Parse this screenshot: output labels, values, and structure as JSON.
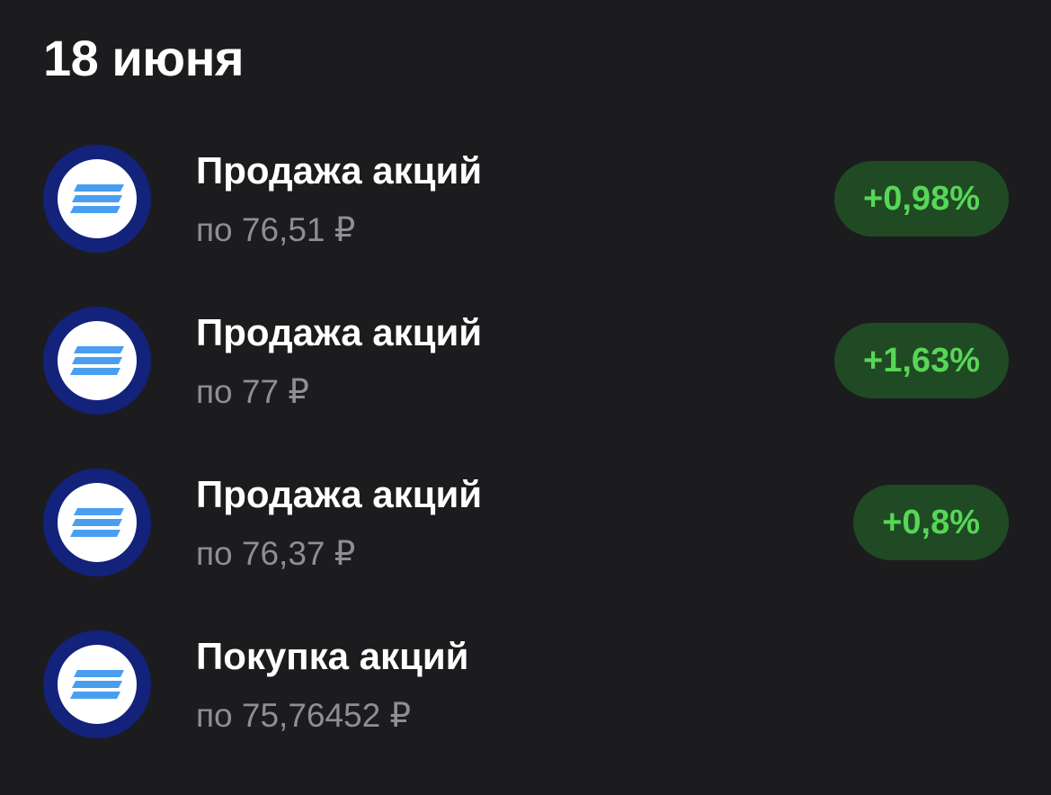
{
  "date_header": "18 июня",
  "operations": [
    {
      "title": "Продажа акций",
      "price": "по 76,51 ₽",
      "change": "+0,98%",
      "icon": "stock-logo-icon"
    },
    {
      "title": "Продажа акций",
      "price": "по 77 ₽",
      "change": "+1,63%",
      "icon": "stock-logo-icon"
    },
    {
      "title": "Продажа акций",
      "price": "по 76,37 ₽",
      "change": "+0,8%",
      "icon": "stock-logo-icon"
    },
    {
      "title": "Покупка акций",
      "price": "по 75,76452 ₽",
      "icon": "stock-logo-icon"
    }
  ],
  "colors": {
    "background": "#1c1c1e",
    "icon_ring": "#13227a",
    "icon_stripes": "#4a9ef0",
    "badge_bg": "#1f4a23",
    "badge_text": "#57d657",
    "secondary_text": "#8e8e93"
  }
}
